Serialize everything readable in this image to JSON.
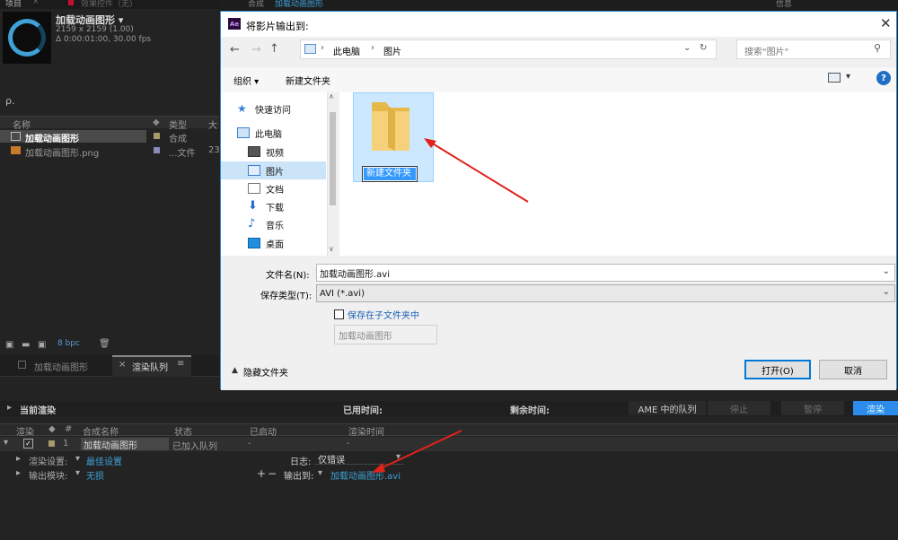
{
  "project": {
    "tab_label": "项目",
    "tab2_label": "效果控件（无）",
    "comp_name": "加载动画图形 ▾",
    "comp_dims": "2159 x 2159 (1.00)",
    "comp_duration": "Δ 0:00:01:00, 30.00 fps",
    "search_glyph": "ρ.",
    "col_name": "名称",
    "col_type": "类型",
    "col_size": "大",
    "items": [
      {
        "name": "加载动画图形",
        "type": "合成",
        "size": ""
      },
      {
        "name": "加载动画图形.png",
        "type": "...文件",
        "size": "23"
      }
    ],
    "bpc": "8 bpc"
  },
  "top_strip": {
    "comp_tab": "合成",
    "comp_tab_sub": "加载动画图形",
    "info": "信息"
  },
  "bottom": {
    "tab1": "加载动画图形",
    "tab2": "渲染队列",
    "current_render": "当前渲染",
    "elapsed": "已用时间:",
    "remaining": "剩余时间:",
    "ame": "AME 中的队列",
    "stop": "停止",
    "pause": "暂停",
    "render": "渲染",
    "columns": [
      "渲染",
      "#",
      "合成名称",
      "状态",
      "已启动",
      "渲染时间"
    ],
    "row": {
      "num": "1",
      "name": "加载动画图形",
      "status": "已加入队列",
      "started": "-",
      "time": "-"
    },
    "render_settings_label": "渲染设置:",
    "render_settings_value": "最佳设置",
    "output_module_label": "输出模块:",
    "output_module_value": "无损",
    "log_label": "日志:",
    "log_value": "仅错误",
    "output_to_label": "输出到:",
    "output_to_value": "加载动画图形.avi"
  },
  "dialog": {
    "title": "将影片输出到:",
    "ae_badge": "Ae",
    "breadcrumb": [
      "此电脑",
      "图片"
    ],
    "search_placeholder": "搜索\"图片\"",
    "organize": "组织 ▾",
    "new_folder": "新建文件夹",
    "help": "?",
    "nav": [
      {
        "label": "快速访问",
        "icon": "star-icon"
      },
      {
        "label": "此电脑",
        "icon": "computer-icon"
      },
      {
        "label": "视频",
        "icon": "video-icon"
      },
      {
        "label": "图片",
        "icon": "pictures-icon"
      },
      {
        "label": "文档",
        "icon": "document-icon"
      },
      {
        "label": "下载",
        "icon": "download-icon"
      },
      {
        "label": "音乐",
        "icon": "music-icon"
      },
      {
        "label": "桌面",
        "icon": "desktop-icon"
      }
    ],
    "folder_name": "新建文件夹",
    "filename_label": "文件名(N):",
    "filename_value": "加载动画图形.avi",
    "filetype_label": "保存类型(T):",
    "filetype_value": "AVI (*.avi)",
    "subfolder_label": "保存在子文件夹中",
    "subfolder_value": "加载动画图形",
    "hide_folders": "隐藏文件夹",
    "open": "打开(O)",
    "cancel": "取消",
    "accent": "#2d89d6"
  }
}
